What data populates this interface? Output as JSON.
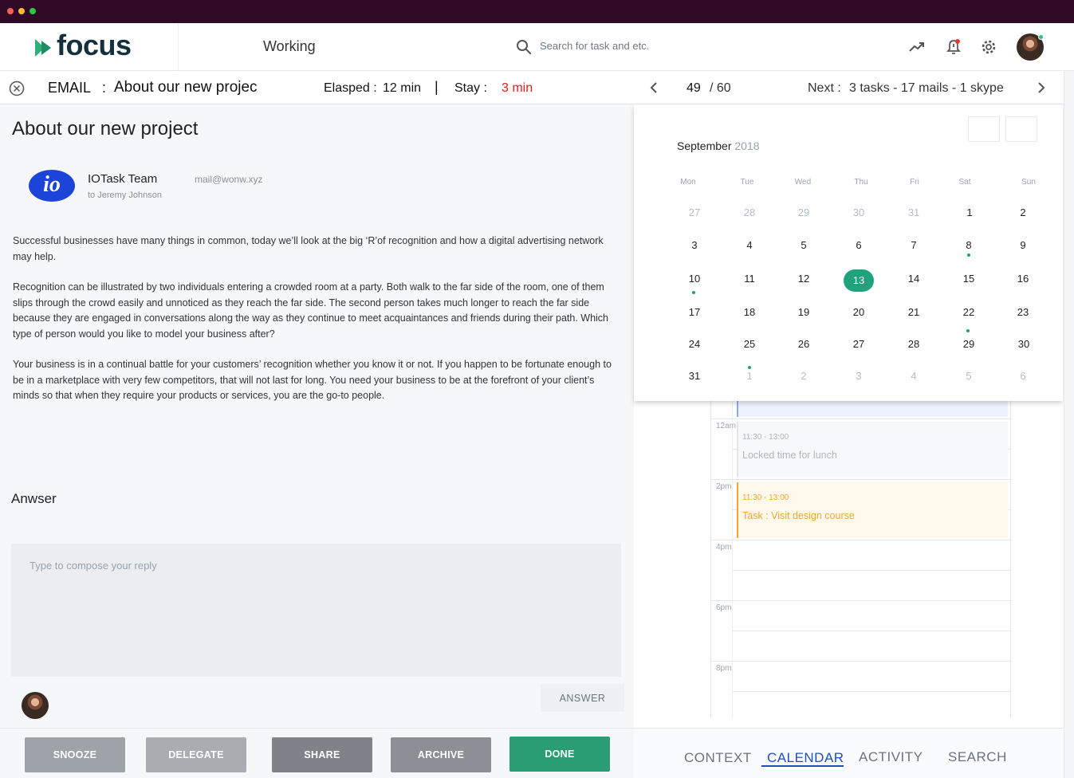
{
  "header": {
    "app_name": "focus",
    "status": "Working",
    "search_placeholder": "Search for task and etc."
  },
  "task_bar": {
    "type": "EMAIL",
    "separator": ":",
    "title": "About our new projec",
    "elapsed_label": "Elasped :",
    "elapsed_value": "12 min",
    "divider": "|",
    "stay_label": "Stay :",
    "stay_value": "3 min",
    "position_current": "49",
    "position_total": "/ 60",
    "next_label": "Next  :",
    "next_summary": "3 tasks - 17 mails - 1 skype"
  },
  "email": {
    "subject": "About our new project",
    "sender_logo_text": "io",
    "sender_name": "IOTask Team",
    "sender_email": "mail@wonw.xyz",
    "recipient": "to Jeremy Johnson",
    "paragraphs": [
      "Successful businesses have many things in common, today we’ll look at the big ‘R’of recognition and how a digital advertising network may help.",
      "Recognition can be illustrated by two individuals entering a crowded room at a party. Both walk to the far side of the room, one of them slips through the crowd easily and unnoticed as they reach the far side. The second person takes much longer to reach the far side because they are engaged in conversations along the way as they continue to meet acquaintances and friends during their path. Which type of person would you like to model your business after?",
      "Your business is in a continual battle for your customers’ recognition whether you know it or not. If you happen to be fortunate enough to be in a marketplace with very few competitors, that will not last for long. You need your business to be at the forefront of your client’s minds so that when they require your products or services, you are the go-to people."
    ]
  },
  "answer": {
    "label": "Anwser",
    "placeholder": "Type to compose your reply",
    "button": "ANSWER"
  },
  "actions": [
    {
      "label": "SNOOZE",
      "color": "#9ea3a9"
    },
    {
      "label": "DELEGATE",
      "color": "#a9acb1"
    },
    {
      "label": "SHARE",
      "color": "#7f8389"
    },
    {
      "label": "ARCHIVE",
      "color": "#8c9096"
    },
    {
      "label": "DONE",
      "color": "#2a9d74"
    }
  ],
  "tabs": [
    {
      "label": "CONTEXT",
      "active": false
    },
    {
      "label": "CALENDAR",
      "active": true
    },
    {
      "label": "ACTIVITY",
      "active": false
    },
    {
      "label": "SEARCH",
      "active": false
    }
  ],
  "calendar": {
    "month": "September",
    "year": "2018",
    "weekdays": [
      "Mon",
      "Tue",
      "Wed",
      "Thu",
      "Fri",
      "Sat",
      "Sun"
    ],
    "weeks": [
      [
        "27",
        "28",
        "29",
        "30",
        "31",
        "1",
        "2"
      ],
      [
        "3",
        "4",
        "5",
        "6",
        "7",
        "8",
        "9"
      ],
      [
        "10",
        "11",
        "12",
        "13",
        "14",
        "15",
        "16"
      ],
      [
        "17",
        "18",
        "19",
        "20",
        "21",
        "22",
        "23"
      ],
      [
        "24",
        "25",
        "26",
        "27",
        "28",
        "29",
        "30"
      ],
      [
        "31",
        "1",
        "2",
        "3",
        "4",
        "5",
        "6"
      ]
    ],
    "selected_day": "13",
    "days_with_events": [
      "8",
      "10",
      "22",
      "25"
    ],
    "accent_color": "#1fa37a"
  },
  "schedule": {
    "hours": [
      "12am",
      "2pm",
      "4pm",
      "6pm",
      "8pm"
    ],
    "events": [
      {
        "time": "11:30 - 13:00",
        "title": "Locked time for lunch",
        "kind": "locked"
      },
      {
        "time": "11:30 - 13:00",
        "title": "Task : Visit design course",
        "kind": "task",
        "color": "#f0a830"
      }
    ]
  }
}
